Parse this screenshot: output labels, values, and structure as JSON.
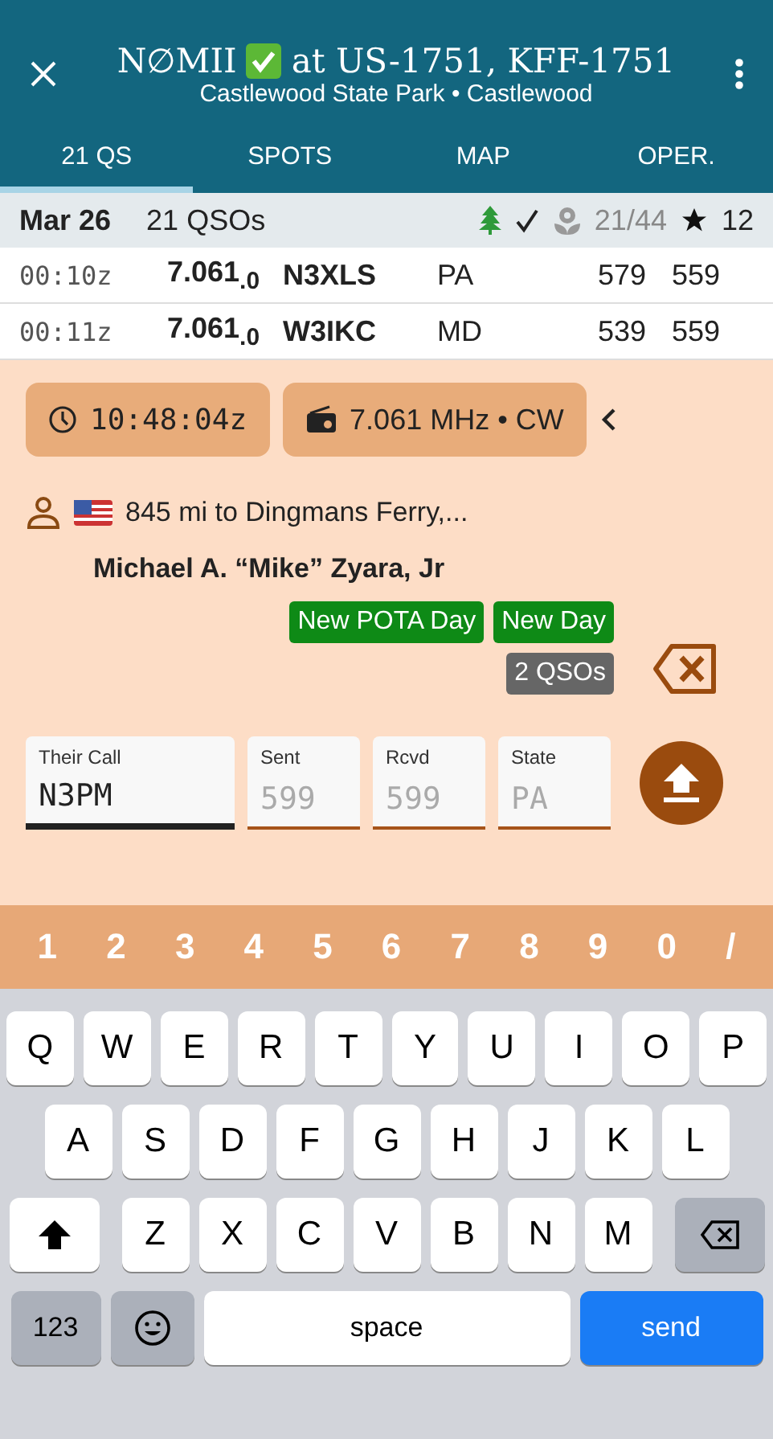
{
  "header": {
    "title_call": "N∅MII",
    "title_rest": "at US-1751, KFF-1751",
    "subtitle": "Castlewood State Park • Castlewood"
  },
  "tabs": [
    {
      "label": "21 QS",
      "selected": true
    },
    {
      "label": "SPOTS",
      "selected": false
    },
    {
      "label": "MAP",
      "selected": false
    },
    {
      "label": "OPER.",
      "selected": false
    }
  ],
  "summary": {
    "date": "Mar 26",
    "count": "21 QSOs",
    "progress": "21/44",
    "stars": "12"
  },
  "log": [
    {
      "time": "00:10z",
      "freq": "7.061$_{.0}$",
      "call": "N3XLS",
      "state": "PA",
      "sent": "579",
      "rcvd": "559"
    },
    {
      "time": "00:11z",
      "freq": "7.061$_{.0}$",
      "call": "W3IKC",
      "state": "MD",
      "sent": "539",
      "rcvd": "559"
    }
  ],
  "chips": [
    {
      "kind": "time",
      "label": "10:48:04z"
    },
    {
      "kind": "radio",
      "label": "7.061 MHz • CW"
    }
  ],
  "info": {
    "location": "845 mi to Dingmans Ferry,...",
    "name": "Michael A. “Mike” Zyara, Jr"
  },
  "badges": [
    {
      "label": "New POTA Day",
      "color": "#0e8a16"
    },
    {
      "label": "New Day",
      "color": "#0e8a16"
    },
    {
      "label": "2 QSOs",
      "color": "#666666"
    }
  ],
  "fields": [
    {
      "label": "Their Call",
      "value": "N3PM",
      "focused": true
    },
    {
      "label": "Sent",
      "placeholder": "599",
      "focused": false
    },
    {
      "label": "Rcvd",
      "placeholder": "599",
      "focused": false
    },
    {
      "label": "State",
      "placeholder": "PA",
      "focused": false
    }
  ],
  "number_row": [
    "1",
    "2",
    "3",
    "4",
    "5",
    "6",
    "7",
    "8",
    "9",
    "0",
    "/"
  ],
  "keyboard": [
    [
      "Q",
      "W",
      "E",
      "R",
      "T",
      "Y",
      "U",
      "I",
      "O",
      "P"
    ],
    [
      "A",
      "S",
      "D",
      "F",
      "G",
      "H",
      "J",
      "K",
      "L"
    ],
    [
      "Z",
      "X",
      "C",
      "V",
      "B",
      "N",
      "M"
    ]
  ],
  "keyboard_bottom": {
    "numbers": "123",
    "space": "space",
    "send": "send"
  }
}
